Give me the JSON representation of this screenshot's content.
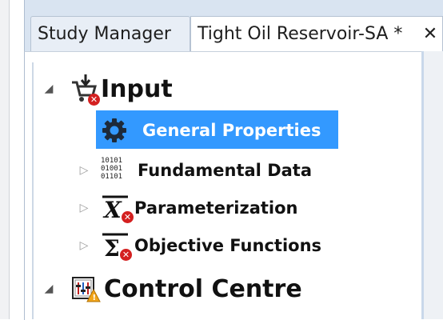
{
  "tabs": {
    "study_manager": "Study Manager",
    "reservoir": "Tight Oil Reservoir-SA *",
    "close_glyph": "✕"
  },
  "tree": {
    "input": "Input",
    "general_properties": "General Properties",
    "fundamental_data": "Fundamental Data",
    "fundamental_binary": [
      "10101",
      "01001",
      "01101"
    ],
    "parameterization": "Parameterization",
    "objective_functions": "Objective Functions",
    "control_centre": "Control Centre"
  },
  "colors": {
    "selection": "#3399ff",
    "error_badge": "#d42020",
    "warning_badge": "#f2a51a"
  }
}
